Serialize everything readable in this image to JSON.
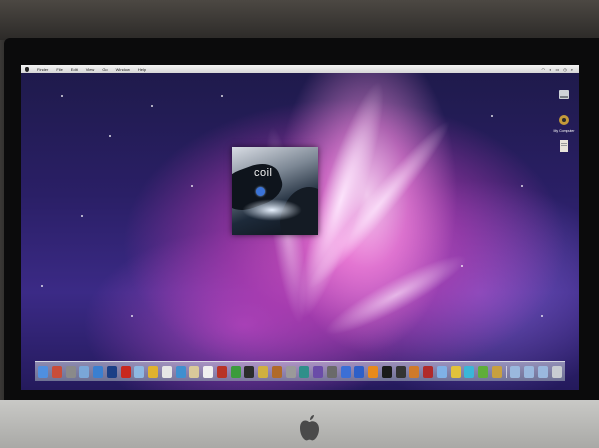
{
  "menubar": {
    "items": [
      "Finder",
      "File",
      "Edit",
      "View",
      "Go",
      "Window",
      "Help"
    ],
    "status_items": [
      "wifi",
      "volume",
      "battery",
      "clock",
      "spotlight"
    ]
  },
  "album": {
    "title": "coil",
    "subtitle": "",
    "disc_color": "#3a73d8"
  },
  "desktop_icons": [
    {
      "name": "hard-drive-icon",
      "label": ""
    },
    {
      "name": "network-folder-icon",
      "label": "My Computer"
    },
    {
      "name": "document-icon",
      "label": "",
      "selected": true
    }
  ],
  "dock": {
    "items": [
      {
        "name": "finder-icon",
        "color": "#4f8fe0"
      },
      {
        "name": "dashboard-icon",
        "color": "#c84d3a"
      },
      {
        "name": "system-preferences-icon",
        "color": "#8a8a8a"
      },
      {
        "name": "mail-icon",
        "color": "#7aa7d8"
      },
      {
        "name": "safari-icon",
        "color": "#3a7fd0"
      },
      {
        "name": "photoshop-icon",
        "color": "#1b3f86"
      },
      {
        "name": "adobe-reader-icon",
        "color": "#c8281e"
      },
      {
        "name": "preview-icon",
        "color": "#8db8e2"
      },
      {
        "name": "chrome-icon",
        "color": "#e0b22e"
      },
      {
        "name": "ical-icon",
        "color": "#e6e6e6"
      },
      {
        "name": "iphoto-icon",
        "color": "#3f8fcf"
      },
      {
        "name": "folder-icon",
        "color": "#d9c99a"
      },
      {
        "name": "textedit-icon",
        "color": "#f0f0f0"
      },
      {
        "name": "app-icon-red",
        "color": "#b83326"
      },
      {
        "name": "app-icon-green",
        "color": "#3c9b3c"
      },
      {
        "name": "app-icon-dark",
        "color": "#2b2b2b"
      },
      {
        "name": "star-icon",
        "color": "#d0b040"
      },
      {
        "name": "guitar-icon",
        "color": "#b06a2a"
      },
      {
        "name": "app-icon-gray",
        "color": "#9a9a9a"
      },
      {
        "name": "app-icon-teal",
        "color": "#2f8f8a"
      },
      {
        "name": "app-icon-purple",
        "color": "#6a4ca8"
      },
      {
        "name": "facetime-icon",
        "color": "#6a6a6a"
      },
      {
        "name": "itunes-icon",
        "color": "#3b6fd6"
      },
      {
        "name": "app-icon-blue",
        "color": "#2d5fc8"
      },
      {
        "name": "vlc-icon",
        "color": "#e88a1a"
      },
      {
        "name": "app-icon-black",
        "color": "#1a1a1a"
      },
      {
        "name": "five-icon",
        "color": "#333333"
      },
      {
        "name": "app-icon-orange",
        "color": "#d07a2a"
      },
      {
        "name": "photo-booth-icon",
        "color": "#b02a2a"
      },
      {
        "name": "app-icon-lightblue",
        "color": "#7fb1e6"
      },
      {
        "name": "app-icon-yellow",
        "color": "#e2c23a"
      },
      {
        "name": "app-icon-cyan",
        "color": "#3ab6d8"
      },
      {
        "name": "app-icon-green2",
        "color": "#5fae3a"
      },
      {
        "name": "app-icon-gold",
        "color": "#c8a040"
      },
      {
        "name": "separator",
        "color": ""
      },
      {
        "name": "applications-stack-icon",
        "color": "#9ab8de"
      },
      {
        "name": "documents-stack-icon",
        "color": "#9ab8de"
      },
      {
        "name": "downloads-stack-icon",
        "color": "#9ab8de"
      },
      {
        "name": "trash-icon",
        "color": "#c8ccd2"
      }
    ]
  },
  "colors": {
    "menubar_bg": "#e4e4e4",
    "selection": "#2d62d4"
  }
}
